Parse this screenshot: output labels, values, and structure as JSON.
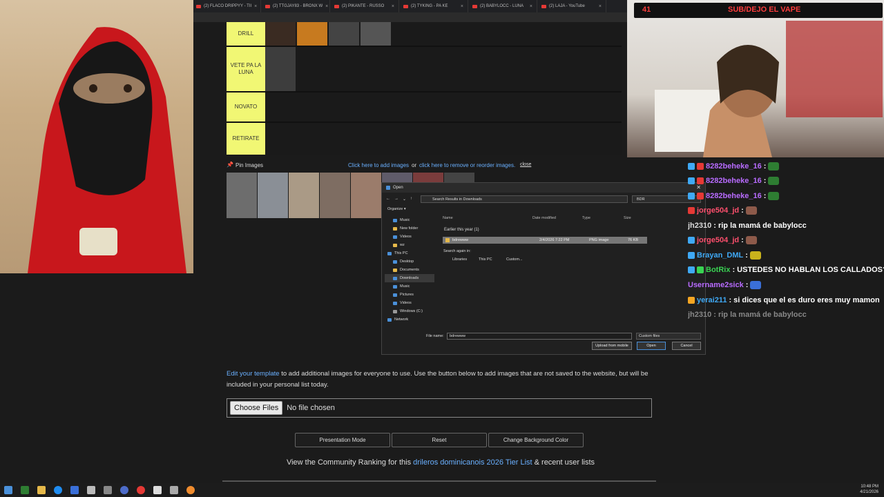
{
  "browser": {
    "tabs": [
      {
        "label": "(2) FLACO DRIPPYY - TII"
      },
      {
        "label": "(2) TTGJAY83 - BRONX W"
      },
      {
        "label": "(2) PIKANTE - RUSSO"
      },
      {
        "label": "(2) TYKING - PA KE"
      },
      {
        "label": "(2) BABYLOCC - LUNA"
      },
      {
        "label": "(2) LAJA - YouTube"
      }
    ]
  },
  "tierlist": {
    "rows": [
      {
        "label": "DRILL",
        "image_count": 4
      },
      {
        "label": "VETE PA LA LUNA",
        "image_count": 1
      },
      {
        "label": "NOVATO",
        "image_count": 0
      },
      {
        "label": "RETIRATE",
        "image_count": 0
      }
    ],
    "label_color": "#f1f774"
  },
  "pinbar": {
    "pin_label": "Pin Images",
    "add_link": "Click here to add images",
    "or": "or",
    "remove_link": "click here to remove or reorder images.",
    "close": "close"
  },
  "dialog": {
    "title": "Open",
    "path": "Search Results in Downloads",
    "search": "BDR",
    "organize": "Organize",
    "new_folder": "New folder",
    "sidebar": [
      {
        "label": "Music"
      },
      {
        "label": "New folder"
      },
      {
        "label": "Videos"
      },
      {
        "label": "wz"
      },
      {
        "label": "This PC"
      },
      {
        "label": "Desktop"
      },
      {
        "label": "Documents"
      },
      {
        "label": "Downloads"
      },
      {
        "label": "Music"
      },
      {
        "label": "Pictures"
      },
      {
        "label": "Videos"
      },
      {
        "label": "Windows (C:)"
      },
      {
        "label": "Network"
      }
    ],
    "columns": {
      "name": "Name",
      "date": "Date modified",
      "type": "Type",
      "size": "Size"
    },
    "group": "Earlier this year (1)",
    "file": {
      "name": "bdrewww",
      "date": "2/4/2026 7:22 PM",
      "type": "PNG image",
      "size": "76 KB"
    },
    "search_again": "Search again in:",
    "search_again_targets": [
      "Libraries",
      "This PC",
      "Custom..."
    ],
    "filename_label": "File name:",
    "filename_value": "bdrewww",
    "filter": "Custom files",
    "btn_upload": "Upload from mobile",
    "btn_open": "Open",
    "btn_cancel": "Cancel"
  },
  "page": {
    "edit_link": "Edit your template",
    "edit_text": " to add additional images for everyone to use. Use the button below to add images that are not saved to the website, but will be included in your personal list today.",
    "choose_files": "Choose Files",
    "no_file": "No file chosen",
    "btn_presentation": "Presentation Mode",
    "btn_reset": "Reset",
    "btn_bg": "Change Background Color",
    "community_prefix": "View the Community Ranking for this ",
    "community_link": "drileros dominicanois 2026 Tier List",
    "community_suffix": " & recent user lists"
  },
  "stream": {
    "viewer_count": "41",
    "banner_title": "SUB/DEJO EL VAPE"
  },
  "chat": [
    {
      "user": "8282beheke_16",
      "text": ":",
      "color": "#b86bff",
      "badges": [
        "#3fa9f5",
        "#e53935"
      ],
      "emote": "#2e7d32"
    },
    {
      "user": "8282beheke_16",
      "text": ":",
      "color": "#b86bff",
      "badges": [
        "#3fa9f5",
        "#e53935"
      ],
      "emote": "#2e7d32"
    },
    {
      "user": "8282beheke_16",
      "text": ":",
      "color": "#b86bff",
      "badges": [
        "#3fa9f5",
        "#e53935"
      ],
      "emote": "#2e7d32"
    },
    {
      "user": "jorge504_jd",
      "text": ":",
      "color": "#ff4f6d",
      "badges": [
        "#e53935"
      ],
      "emote": "#8d5a4a"
    },
    {
      "user": "jh2310",
      "text": ": rip la mamá de babylocc",
      "color": "#dddddd",
      "badges": [],
      "emote": ""
    },
    {
      "user": "jorge504_jd",
      "text": ":",
      "color": "#ff4f6d",
      "badges": [
        "#3fa9f5"
      ],
      "emote": "#8d5a4a"
    },
    {
      "user": "Brayan_DML",
      "text": ":",
      "color": "#3fa9f5",
      "badges": [
        "#3fa9f5"
      ],
      "emote": "#c9b21c"
    },
    {
      "user": "BotRix",
      "text": ": USTEDES NO HABLAN LOS CALLADOS?",
      "color": "#39d353",
      "badges": [
        "#3fa9f5",
        "#39d353"
      ],
      "emote": ""
    },
    {
      "user": "Username2sick",
      "text": ":",
      "color": "#b86bff",
      "badges": [],
      "emote": "#3a6fd8"
    },
    {
      "user": "yerai211",
      "text": ": si dices que el es duro eres muy mamon",
      "color": "#3fa9f5",
      "badges": [
        "#f5a623"
      ],
      "emote": ""
    },
    {
      "user": "jh2310",
      "text": ": rip la mamá de babylocc",
      "color": "#888888",
      "badges": [],
      "emote": ""
    }
  ],
  "taskbar": {
    "time": "10:48 PM",
    "date": "4/21/2026"
  }
}
